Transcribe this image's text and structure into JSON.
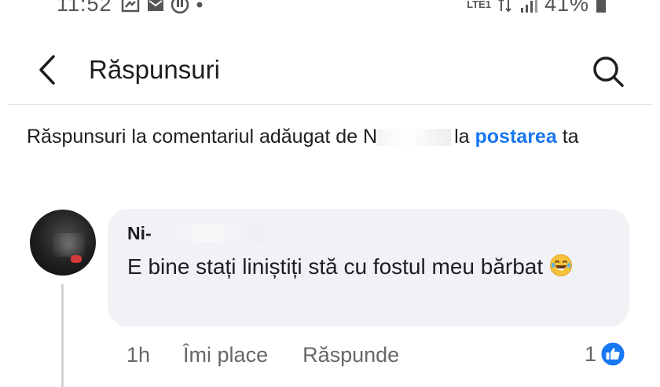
{
  "status_bar": {
    "time": "11:52",
    "network": "LTE1",
    "battery": "41%"
  },
  "header": {
    "title": "Răspunsuri"
  },
  "context": {
    "prefix": "Răspunsuri la comentariul adăugat de N",
    "middle": "la",
    "link": "postarea",
    "suffix": "ta"
  },
  "comment": {
    "author": "Ni-",
    "text": "E bine stați liniștiți stă cu fostul meu bărbat",
    "time": "1h",
    "like_label": "Îmi place",
    "reply_label": "Răspunde",
    "reaction_count": "1"
  },
  "colors": {
    "accent": "#1877f2",
    "bubble": "#f0f2f5",
    "secondary_text": "#65676b"
  },
  "icons": {
    "back": "chevron-left-icon",
    "search": "search-icon",
    "reaction": "like-icon",
    "emoji": "laughing-tears-emoji"
  }
}
